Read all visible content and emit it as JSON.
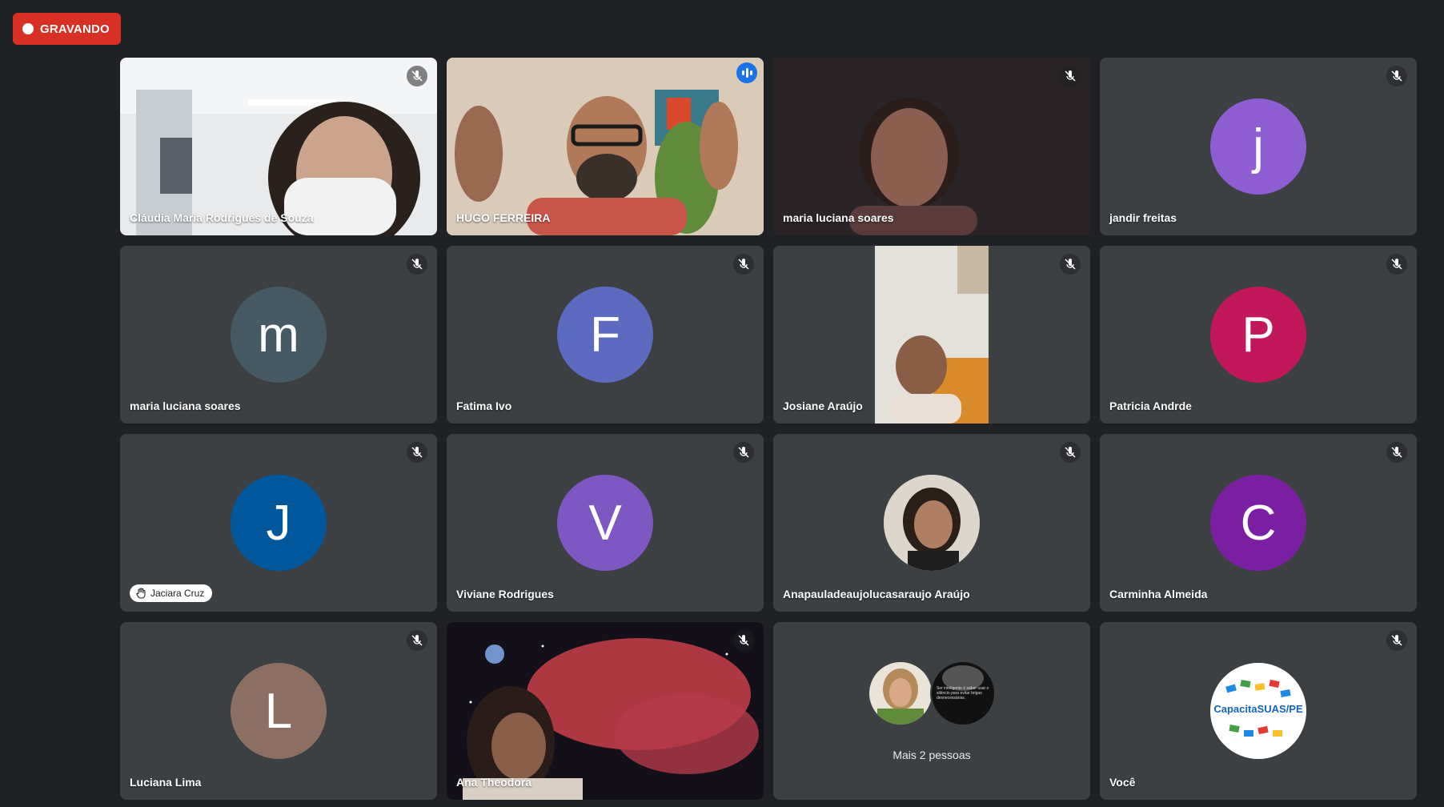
{
  "recording": {
    "label": "GRAVANDO"
  },
  "tiles": [
    {
      "name": "Cláudia Maria Rodrigues de Souza",
      "kind": "video"
    },
    {
      "name": "HUGO FERREIRA",
      "kind": "video",
      "speaking": true
    },
    {
      "name": "maria luciana soares",
      "kind": "video"
    },
    {
      "name": "jandir freitas",
      "initial": "j",
      "color": "#8e5dd1"
    },
    {
      "name": "maria luciana soares",
      "initial": "m",
      "color": "#455a64"
    },
    {
      "name": "Fatima Ivo",
      "initial": "F",
      "color": "#5c6bc0"
    },
    {
      "name": "Josiane Araújo",
      "kind": "video"
    },
    {
      "name": "Patricia Andrde",
      "initial": "P",
      "color": "#c2185b"
    },
    {
      "name": "Jaciara Cruz",
      "initial": "J",
      "color": "#01579b",
      "hand_raised": true
    },
    {
      "name": "Viviane Rodrigues",
      "initial": "V",
      "color": "#7e57c2"
    },
    {
      "name": "Anapauladeaujolucasaraujo Araújo",
      "kind": "photo-avatar"
    },
    {
      "name": "Carminha Almeida",
      "initial": "C",
      "color": "#7b1fa2"
    },
    {
      "name": "Luciana Lima",
      "initial": "L",
      "color": "#8d6e63"
    },
    {
      "name": "Ana Theodora",
      "kind": "video"
    },
    {
      "kind": "more",
      "label": "Mais 2 pessoas",
      "quote": "Ser inteligente é saber usar o silêncio para evitar brigas desnecessárias."
    },
    {
      "name": "Você",
      "kind": "logo",
      "logo_text": "CapacitaSUAS/PE"
    }
  ],
  "icons": {
    "mic_off": "mic-off-icon",
    "hand": "raised-hand-icon",
    "speaking": "speaking-indicator-icon"
  }
}
